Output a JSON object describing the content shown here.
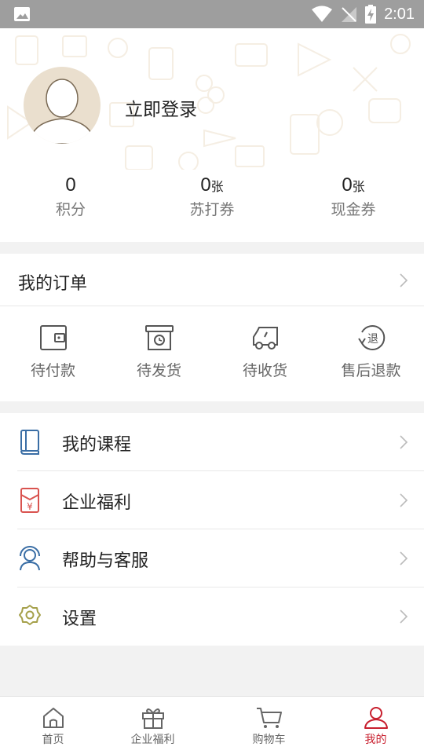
{
  "status_bar": {
    "time": "2:01"
  },
  "profile": {
    "login_text": "立即登录"
  },
  "stats": [
    {
      "value": "0",
      "unit": "",
      "label": "积分"
    },
    {
      "value": "0",
      "unit": "张",
      "label": "苏打券"
    },
    {
      "value": "0",
      "unit": "张",
      "label": "现金券"
    }
  ],
  "orders": {
    "title": "我的订单",
    "items": [
      {
        "label": "待付款",
        "icon": "wallet-icon"
      },
      {
        "label": "待发货",
        "icon": "box-clock-icon"
      },
      {
        "label": "待收货",
        "icon": "truck-icon"
      },
      {
        "label": "售后退款",
        "icon": "refund-icon",
        "glyph": "退"
      }
    ]
  },
  "menu": [
    {
      "label": "我的课程",
      "icon": "book-icon"
    },
    {
      "label": "企业福利",
      "icon": "red-envelope-icon",
      "glyph": "¥"
    },
    {
      "label": "帮助与客服",
      "icon": "headset-icon"
    },
    {
      "label": "设置",
      "icon": "gear-icon"
    }
  ],
  "tabbar": [
    {
      "label": "首页",
      "icon": "home-icon",
      "active": false
    },
    {
      "label": "企业福利",
      "icon": "gift-icon",
      "active": false
    },
    {
      "label": "购物车",
      "icon": "cart-icon",
      "active": false
    },
    {
      "label": "我的",
      "icon": "user-icon",
      "active": true
    }
  ],
  "colors": {
    "accent": "#c8202f",
    "icon_blue": "#3a6ea5",
    "icon_red": "#d9534f",
    "icon_olive": "#a5a04a",
    "status_bar": "#9e9e9e"
  }
}
